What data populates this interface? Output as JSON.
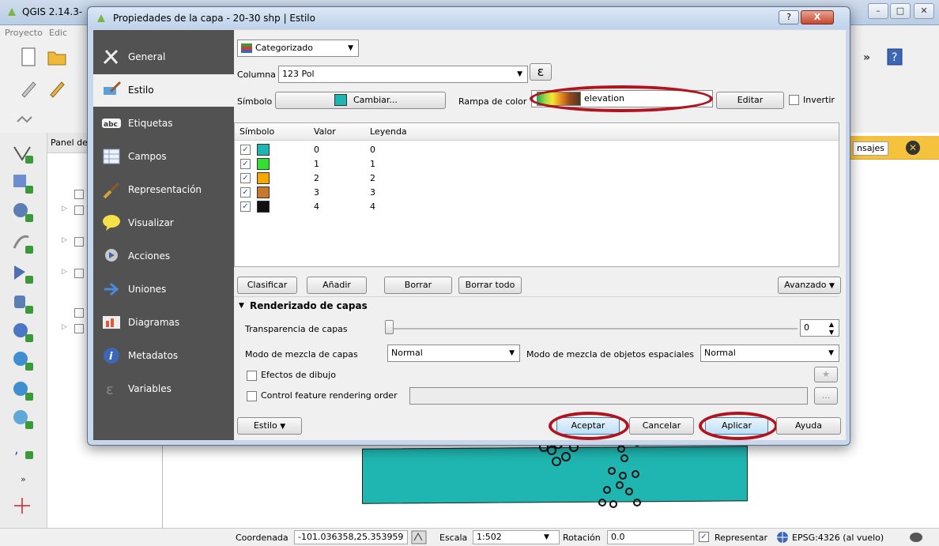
{
  "app": {
    "title": "QGIS 2.14.3-",
    "menu": [
      "Proyecto",
      "Edic"
    ],
    "layers_panel_title": "Panel de"
  },
  "message_bar": {
    "button": "nsajes",
    "close_glyph": "✕",
    "color": "#f5c23e"
  },
  "dialog": {
    "title": "Propiedades de la capa - 20-30 shp | Estilo",
    "help_glyph": "?",
    "close_glyph": "X",
    "sidebar": [
      {
        "label": "General",
        "icon": "tools-icon"
      },
      {
        "label": "Estilo",
        "icon": "paintbrush-icon",
        "active": true
      },
      {
        "label": "Etiquetas",
        "icon": "abc-label-icon"
      },
      {
        "label": "Campos",
        "icon": "table-fields-icon"
      },
      {
        "label": "Representación",
        "icon": "brush-icon"
      },
      {
        "label": "Visualizar",
        "icon": "speech-bubble-icon"
      },
      {
        "label": "Acciones",
        "icon": "gear-play-icon"
      },
      {
        "label": "Uniones",
        "icon": "join-arrow-icon"
      },
      {
        "label": "Diagramas",
        "icon": "pie-chart-icon"
      },
      {
        "label": "Metadatos",
        "icon": "info-icon"
      },
      {
        "label": "Variables",
        "icon": "epsilon-icon"
      }
    ],
    "renderer": "Categorizado",
    "column_label": "Columna",
    "column_value": "123 Pol",
    "expression_glyph": "ε",
    "symbol_label": "Símbolo",
    "symbol_button": "Cambiar...",
    "ramp_label": "Rampa de color",
    "ramp_value": "elevation",
    "edit_button": "Editar",
    "invert_label": "Invertir",
    "table": {
      "headers": [
        "Símbolo",
        "Valor",
        "Leyenda"
      ],
      "rows": [
        {
          "value": "0",
          "legend": "0",
          "color": "#1fb5b0"
        },
        {
          "value": "1",
          "legend": "1",
          "color": "#31e030"
        },
        {
          "value": "2",
          "legend": "2",
          "color": "#f5a800"
        },
        {
          "value": "3",
          "legend": "3",
          "color": "#c8782c"
        },
        {
          "value": "4",
          "legend": "4",
          "color": "#111111"
        }
      ]
    },
    "buttons": {
      "classify": "Clasificar",
      "add": "Añadir",
      "delete": "Borrar",
      "delete_all": "Borrar todo",
      "advanced": "Avanzado"
    },
    "render_section": {
      "title": "Renderizado de capas",
      "transparency_label": "Transparencia de capas",
      "transparency_value": "0",
      "blend_label": "Modo de mezcla de capas",
      "blend_value": "Normal",
      "feature_blend_label": "Modo de mezcla de objetos espaciales",
      "feature_blend_value": "Normal",
      "draw_effects_label": "Efectos de dibujo",
      "control_order_label": "Control feature rendering order",
      "ellipsis": "..."
    },
    "footer": {
      "style": "Estilo",
      "accept": "Aceptar",
      "cancel": "Cancelar",
      "apply": "Aplicar",
      "help": "Ayuda"
    }
  },
  "status_bar": {
    "coord_label": "Coordenada",
    "coord_value": "-101.036358,25.353959",
    "scale_label": "Escala",
    "scale_value": "1:502",
    "rotation_label": "Rotación",
    "rotation_value": "0.0",
    "render_label": "Representar",
    "crs": "EPSG:4326 (al vuelo)"
  },
  "colors": {
    "highlight_oval": "#b2141f",
    "polygon_fill": "#1fb5b0"
  }
}
